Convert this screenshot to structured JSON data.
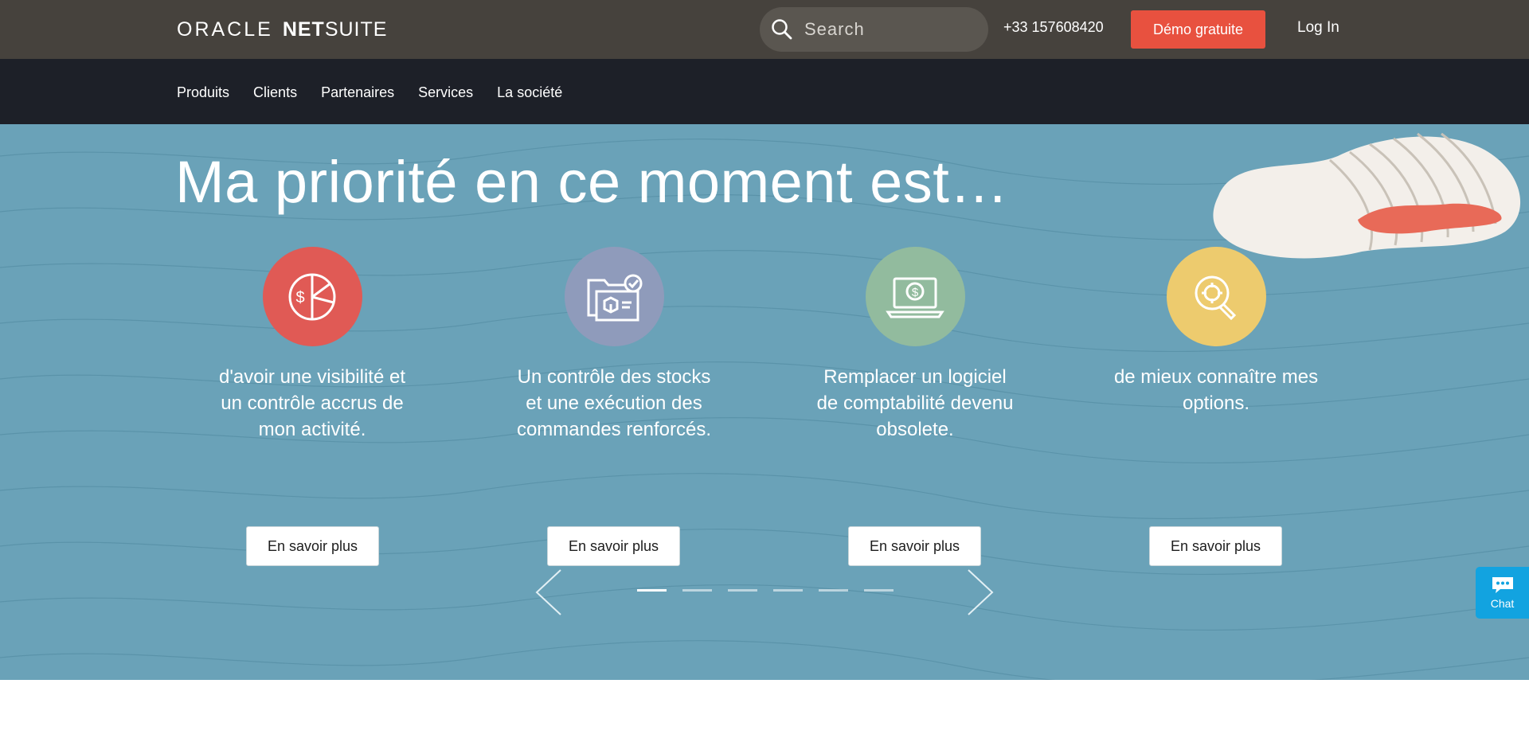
{
  "brand": {
    "oracle": "ORACLE",
    "net": "NET",
    "suite": "SUITE"
  },
  "header": {
    "search_placeholder": "Search",
    "phone": "+33 157608420",
    "demo_label": "Démo gratuite",
    "login_label": "Log In"
  },
  "nav": {
    "items": [
      {
        "label": "Produits"
      },
      {
        "label": "Clients"
      },
      {
        "label": "Partenaires"
      },
      {
        "label": "Services"
      },
      {
        "label": "La société"
      }
    ]
  },
  "hero": {
    "title": "Ma priorité en ce moment est…",
    "cards": [
      {
        "text": "d'avoir une visibilité et un contrôle accrus de mon activité.",
        "button": "En savoir plus",
        "icon": "pie-chart-dollar-icon",
        "color": "#e05a55"
      },
      {
        "text": "Un contrôle des stocks et une exécution des commandes renforcés.",
        "button": "En savoir plus",
        "icon": "inventory-folder-icon",
        "color": "#8f9bbb"
      },
      {
        "text": "Remplacer un logiciel de comptabilité devenu obsolete.",
        "button": "En savoir plus",
        "icon": "laptop-dollar-icon",
        "color": "#92bb9e"
      },
      {
        "text": "de mieux connaître mes options.",
        "button": "En savoir plus",
        "icon": "magnifier-target-icon",
        "color": "#edcb6e"
      }
    ],
    "slides_total": 6,
    "active_slide": 1
  },
  "chat": {
    "label": "Chat"
  },
  "colors": {
    "topbar": "#46423d",
    "navbar": "#1d2028",
    "hero": "#6aa2b8",
    "accent": "#e8513f",
    "chat": "#12a3e0"
  }
}
